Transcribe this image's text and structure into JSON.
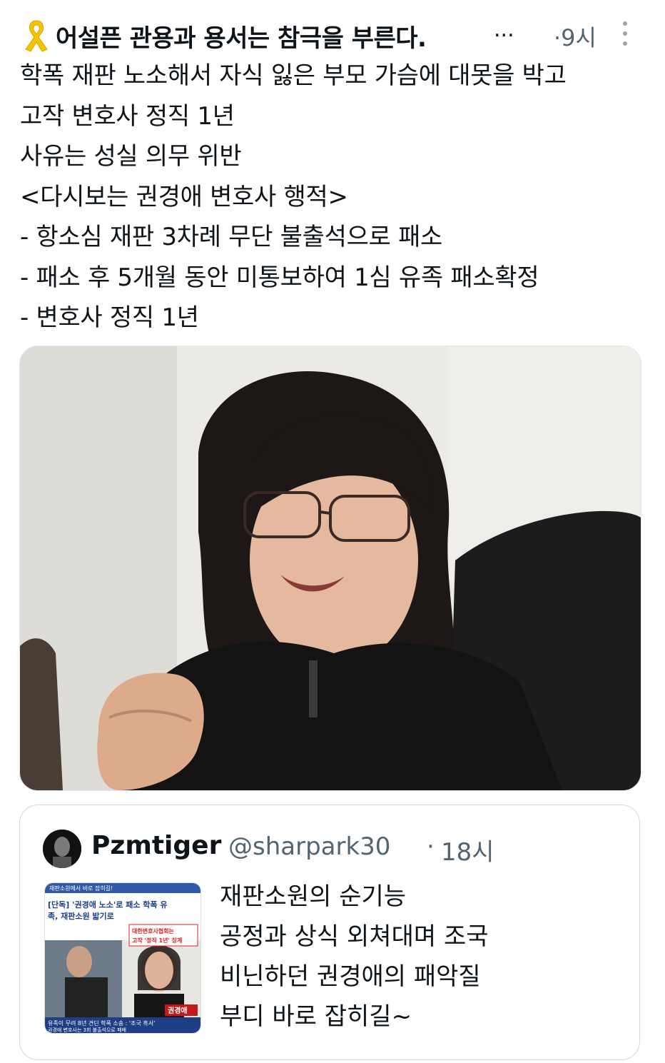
{
  "tweet": {
    "author_name": "어설픈 관용과 용서는 참극을 부른다.",
    "ellipsis": "...",
    "time": "·9시",
    "lines": [
      "학폭 재판 노소해서 자식 잃은 부모 가슴에 대못을 박고",
      "고작 변호사 정직 1년",
      "사유는 성실 의무 위반",
      "<다시보는 권경애 변호사 행적>",
      "- 항소심 재판 3차례 무단 불출석으로 패소",
      "- 패소 후 5개월 동안 미통보하여 1심 유족 패소확정",
      "- 변호사 정직 1년"
    ]
  },
  "quoted": {
    "name": "Pzmtiger",
    "handle": "@sharpark30",
    "dot": "·",
    "time": "18시",
    "lines": [
      "재판소원의 순기능",
      "공정과 상식 외쳐대며 조국",
      "비닌하던 권경애의 패악질",
      "부디 바로 잡히길~"
    ],
    "thumbnail": {
      "top_bar": "재판소원에서 바로 잡히길!",
      "headline_1": "[단독] '권경애 노소'로 패소 학폭 유",
      "headline_2": "족, 재판소원 밟기로",
      "badge_1": "대한변호사협회는",
      "badge_2": "고작 '정직 1년' 징계",
      "name_tag": "권경애",
      "caption_1": "유족이 무려 8년 견딘 학폭 소송 : '조국 흑서'",
      "caption_2": "권경애 변호사는 3회 불출석으로 패배"
    }
  },
  "colors": {
    "text": "#0f1419",
    "secondary": "#536471",
    "border": "#cfd9de",
    "ribbon": "#f5c400"
  },
  "icons": {
    "ribbon": "yellow-ribbon-icon",
    "more": "more-vertical-icon"
  }
}
